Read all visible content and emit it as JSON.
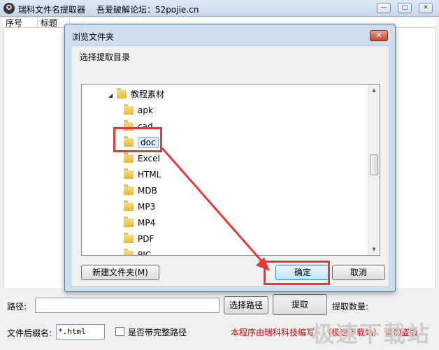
{
  "main": {
    "title": "瑞科文件名提取器",
    "subtitle": "吾爱破解论坛：52pojie.cn",
    "controls": [
      "—",
      "□",
      "✕"
    ]
  },
  "list": {
    "columns": [
      "序号",
      "标题"
    ]
  },
  "bottom": {
    "path_label": "路径:",
    "path_value": "",
    "choose_path_button": "选择路径",
    "extract_button": "提取",
    "count_label": "提取数量:",
    "suffix_label": "文件后缀名:",
    "suffix_value": "*.html",
    "full_path_label": "是否带完整路径",
    "note": "本程序由瑞科科技编写",
    "note2": "（极速下载站）  请勿盗版",
    "watermark": "极速下载站"
  },
  "dialog": {
    "title": "浏览文件夹",
    "close": "✕",
    "prompt": "选择提取目录",
    "parent_folder": "教程素材",
    "folders": [
      "apk",
      "cad",
      "doc",
      "Excel",
      "HTML",
      "MDB",
      "MP3",
      "MP4",
      "PDF",
      "PIC"
    ],
    "selected_index": 2,
    "new_folder_button": "新建文件夹(M)",
    "ok_button": "确定",
    "cancel_button": "取消"
  },
  "colors": {
    "annotation_red": "#e03a3a",
    "selection_bg": "#dcebfc"
  }
}
